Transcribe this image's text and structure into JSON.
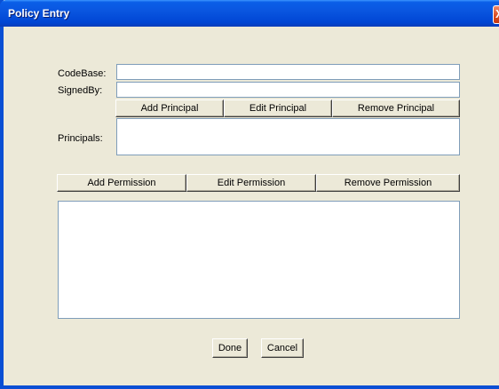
{
  "window": {
    "title": "Policy Entry",
    "close_glyph": "X"
  },
  "form": {
    "codebase_label": "CodeBase:",
    "codebase_value": "",
    "signedby_label": "SignedBy:",
    "signedby_value": "",
    "principals_label": "Principals:"
  },
  "principal_buttons": {
    "add": "Add Principal",
    "edit": "Edit Principal",
    "remove": "Remove Principal"
  },
  "permission_buttons": {
    "add": "Add Permission",
    "edit": "Edit Permission",
    "remove": "Remove Permission"
  },
  "dialog_buttons": {
    "done": "Done",
    "cancel": "Cancel"
  },
  "icons": {
    "close": "close-icon"
  }
}
